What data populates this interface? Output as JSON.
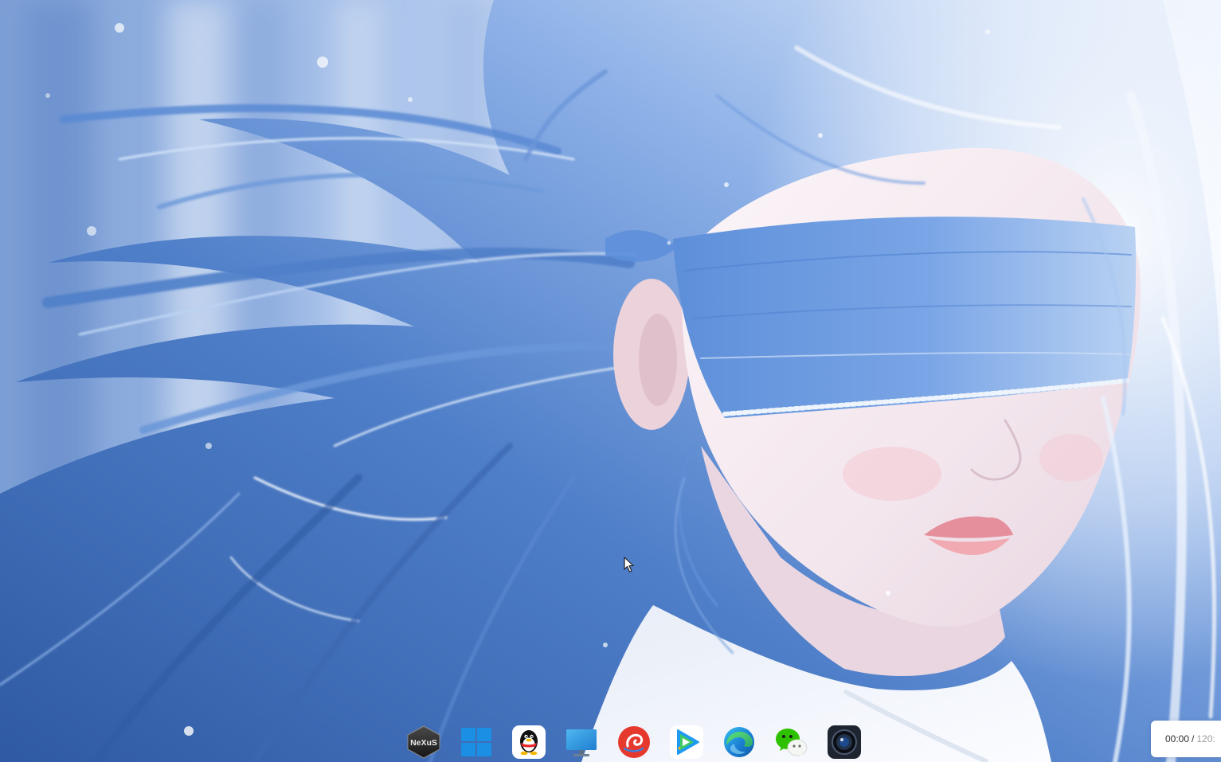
{
  "wallpaper": {
    "colors": {
      "sky_light": "#f4f8fe",
      "sky_mid": "#a9c2ea",
      "sky_dark": "#7c9fd6",
      "hair": "#4f7fc9",
      "hair_highlight": "#cfe0f7",
      "blindfold": "#7aa5e6",
      "skin": "#f6ecf1",
      "lips": "#e58f9c",
      "hoodie": "#f5f7fc"
    }
  },
  "dock": {
    "items": [
      {
        "icon": "nexus-icon",
        "logo_text": "NeXuS"
      },
      {
        "icon": "windows-start-icon"
      },
      {
        "icon": "qq-penguin-icon"
      },
      {
        "icon": "desktop-monitor-icon"
      },
      {
        "icon": "red-swirl-app-icon"
      },
      {
        "icon": "tencent-video-icon"
      },
      {
        "icon": "edge-browser-icon"
      },
      {
        "icon": "wechat-icon"
      },
      {
        "icon": "camera-icon"
      }
    ]
  },
  "cursor": {
    "icon": "mouse-pointer-icon"
  },
  "timer": {
    "elapsed": "00:00",
    "separator": "/",
    "total": "120:"
  }
}
